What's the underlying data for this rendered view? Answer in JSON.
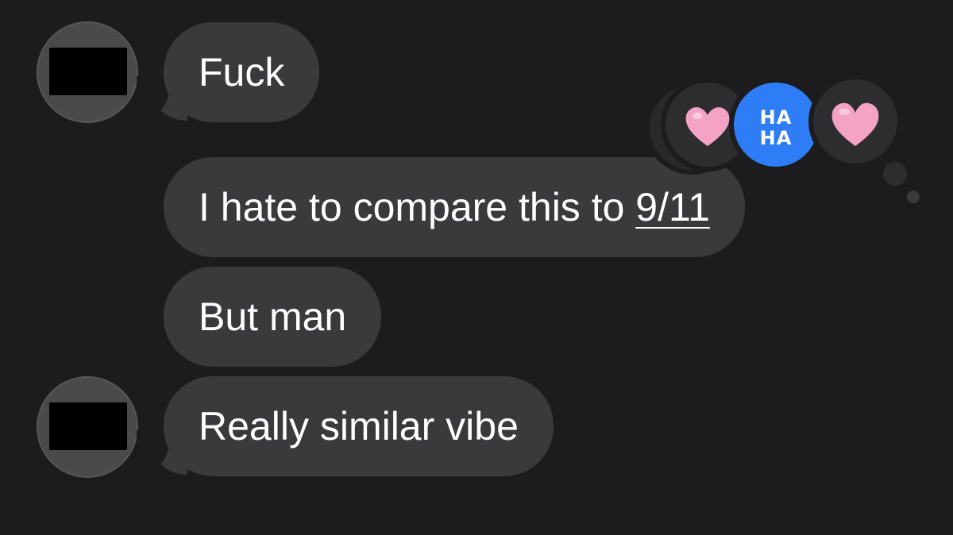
{
  "colors": {
    "background": "#1c1c1e",
    "incoming_bubble": "#3a3a3c",
    "bubble_text": "#ffffff",
    "tapback_bg": "#2d2d30",
    "haha_bg": "#2f7df6",
    "heart": "#f4a3c4"
  },
  "messages": [
    {
      "text": "Fuck",
      "sender": "redacted",
      "show_avatar": true
    },
    {
      "text_before_link": "I hate to compare this to ",
      "link_text": "9/11",
      "sender": "redacted",
      "show_avatar": false
    },
    {
      "text": "But man",
      "sender": "redacted",
      "show_avatar": false
    },
    {
      "text": "Really similar vibe",
      "sender": "redacted",
      "show_avatar": true
    }
  ],
  "tapbacks": {
    "haha": {
      "line1": "HA",
      "line2": "HA"
    },
    "icons": [
      "heart-icon",
      "haha-icon",
      "heart-icon"
    ]
  }
}
